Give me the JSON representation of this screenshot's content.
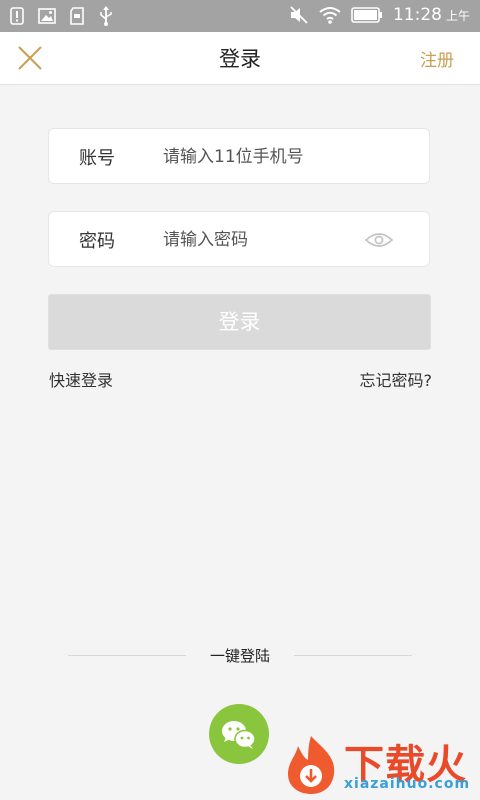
{
  "status_bar": {
    "time": "11:28",
    "ampm": "上午",
    "icons": [
      "sim-alert-icon",
      "image-icon",
      "sd-card-icon",
      "usb-icon",
      "mute-icon",
      "wifi-icon",
      "battery-icon"
    ]
  },
  "header": {
    "title": "登录",
    "register_label": "注册",
    "close_icon": "close-icon"
  },
  "form": {
    "account_label": "账号",
    "account_placeholder": "请输入11位手机号",
    "password_label": "密码",
    "password_placeholder": "请输入密码",
    "login_button": "登录",
    "quick_login": "快速登录",
    "forgot_password": "忘记密码?"
  },
  "onekey": {
    "label": "一键登陆"
  },
  "watermark": {
    "brand": "下载火",
    "url": "xiazaihuo.com"
  },
  "colors": {
    "accent": "#c9a052",
    "wechat_green": "#8ac53e",
    "status_bar": "#a3a3a3",
    "background": "#f4f4f4"
  }
}
